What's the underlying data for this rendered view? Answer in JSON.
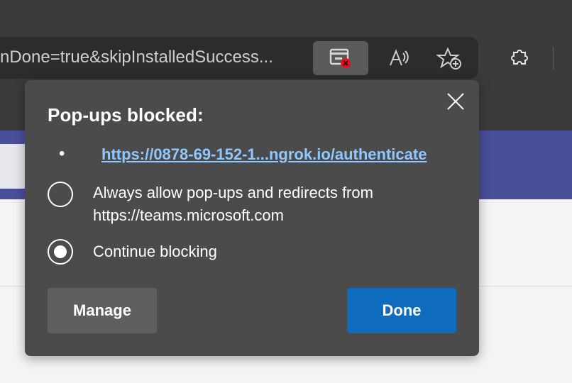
{
  "browser": {
    "address_text": "nDone=true&skipInstalledSuccess...",
    "icons": {
      "popup_blocked": "popup-blocked-icon",
      "read_aloud": "read-aloud-icon",
      "favorite_add": "favorite-add-icon",
      "extensions": "extensions-icon"
    }
  },
  "popup": {
    "title": "Pop-ups blocked:",
    "bullet": "•",
    "blocked_url": "https://0878-69-152-1...ngrok.io/authenticate",
    "option_always_line1": "Always allow pop-ups and redirects from",
    "option_always_line2": "https://teams.microsoft.com",
    "option_continue": "Continue blocking",
    "manage_label": "Manage",
    "done_label": "Done"
  },
  "colors": {
    "popup_bg": "#4b4b4b",
    "link": "#8fc8ff",
    "done_button": "#0f6cbd",
    "manage_button": "#5f5f5f",
    "teams_purple": "#4a4f9a"
  }
}
